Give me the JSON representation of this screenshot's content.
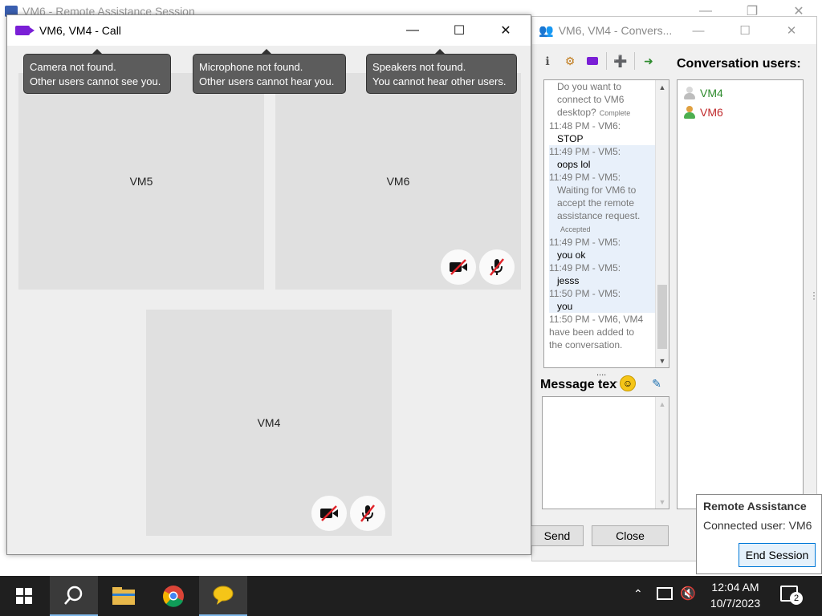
{
  "background_window": {
    "title": "VM6 - Remote Assistance Session"
  },
  "call_window": {
    "title": "VM6, VM4 - Call",
    "tooltips": [
      {
        "line1": "Camera not found.",
        "line2": "Other users cannot see you."
      },
      {
        "line1": "Microphone not found.",
        "line2": "Other users cannot hear you."
      },
      {
        "line1": "Speakers not found.",
        "line2": "You cannot hear other users."
      }
    ],
    "tiles": [
      {
        "label": "VM5"
      },
      {
        "label": "VM6"
      },
      {
        "label": "VM4"
      }
    ]
  },
  "conversation_window": {
    "title": "VM6, VM4 - Convers...",
    "users_label": "Conversation users:",
    "users": [
      {
        "name": "VM4",
        "color": "#2e8b2e"
      },
      {
        "name": "VM6",
        "color": "#c0282a"
      }
    ],
    "chat": [
      {
        "kind": "msg-grey",
        "text": "Do you want to"
      },
      {
        "kind": "msg-grey",
        "text": "connect to VM6"
      },
      {
        "kind": "msg-grey",
        "text": "desktop?",
        "small": "Complete"
      },
      {
        "kind": "meta",
        "text": "11:48 PM - VM6:"
      },
      {
        "kind": "msg",
        "text": "STOP"
      },
      {
        "kind": "meta",
        "text": "11:49 PM - VM5:",
        "hl": true
      },
      {
        "kind": "msg",
        "text": "oops lol",
        "hl": true
      },
      {
        "kind": "meta",
        "text": "11:49 PM - VM5:",
        "hl": true
      },
      {
        "kind": "msg-grey",
        "text": "Waiting for VM6 to",
        "hl": true
      },
      {
        "kind": "msg-grey",
        "text": "accept the remote",
        "hl": true
      },
      {
        "kind": "msg-grey",
        "text": "assistance request.",
        "hl": true
      },
      {
        "kind": "msg-grey",
        "text": "",
        "small": "Accepted",
        "hl": true
      },
      {
        "kind": "meta",
        "text": "11:49 PM - VM5:",
        "hl": true
      },
      {
        "kind": "msg",
        "text": "you ok",
        "hl": true
      },
      {
        "kind": "meta",
        "text": "11:49 PM - VM5:",
        "hl": true
      },
      {
        "kind": "msg",
        "text": "jesss",
        "hl": true
      },
      {
        "kind": "meta",
        "text": "11:50 PM - VM5:",
        "hl": true
      },
      {
        "kind": "msg",
        "text": "you",
        "hl": true
      },
      {
        "kind": "meta",
        "text": "11:50 PM - VM6, VM4"
      },
      {
        "kind": "meta",
        "text": "have been added to"
      },
      {
        "kind": "meta",
        "text": "the conversation."
      }
    ],
    "message_label": "Message text:",
    "dots": "....",
    "send_label": "Send",
    "close_label": "Close"
  },
  "notification": {
    "title": "Remote Assistance",
    "text": "Connected user: VM6",
    "button": "End Session"
  },
  "taskbar": {
    "time": "12:04 AM",
    "date": "10/7/2023",
    "notification_count": "2"
  }
}
